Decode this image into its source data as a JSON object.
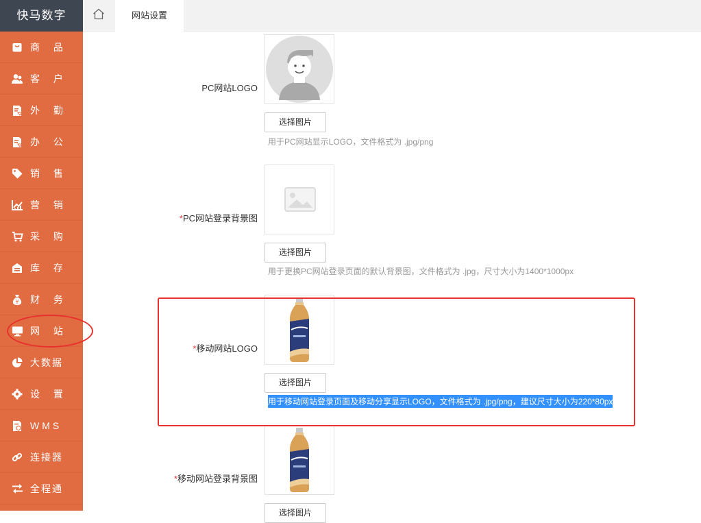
{
  "brand": "快马数字",
  "sidebar": {
    "items": [
      {
        "label": "商 品",
        "icon": "bag-icon"
      },
      {
        "label": "客 户",
        "icon": "users-icon"
      },
      {
        "label": "外 勤",
        "icon": "field-report-icon"
      },
      {
        "label": "办 公",
        "icon": "office-report-icon"
      },
      {
        "label": "销 售",
        "icon": "tag-icon"
      },
      {
        "label": "营 销",
        "icon": "trend-chart-icon"
      },
      {
        "label": "采 购",
        "icon": "cart-icon"
      },
      {
        "label": "库 存",
        "icon": "warehouse-icon"
      },
      {
        "label": "财 务",
        "icon": "money-bag-icon"
      },
      {
        "label": "网 站",
        "icon": "monitor-icon"
      },
      {
        "label": "大数据",
        "icon": "pie-chart-icon"
      },
      {
        "label": "设 置",
        "icon": "gear-icon"
      },
      {
        "label": "WMS",
        "icon": "wms-icon"
      },
      {
        "label": "连接器",
        "icon": "link-icon"
      },
      {
        "label": "全程通",
        "icon": "swap-arrows-icon"
      }
    ]
  },
  "tabs": {
    "home_icon": "home-icon",
    "active": "网站设置"
  },
  "form": {
    "pc_logo": {
      "label": "PC网站LOGO",
      "button": "选择图片",
      "hint": "用于PC网站显示LOGO，文件格式为 .jpg/png"
    },
    "pc_login_bg": {
      "required_mark": "*",
      "label": "PC网站登录背景图",
      "button": "选择图片",
      "hint": "用于更换PC网站登录页面的默认背景图，文件格式为 .jpg，尺寸大小为1400*1000px"
    },
    "mobile_logo": {
      "required_mark": "*",
      "label": "移动网站LOGO",
      "button": "选择图片",
      "hint": "用于移动网站登录页面及移动分享显示LOGO，文件格式为 .jpg/png，建议尺寸大小为220*80px"
    },
    "mobile_login_bg": {
      "required_mark": "*",
      "label": "移动网站登录背景图",
      "button": "选择图片"
    }
  },
  "colors": {
    "sidebar": "#e26c42",
    "brand_bg": "#3e4652",
    "annotation_red": "#e8302d",
    "selection_blue": "#3390ff"
  }
}
